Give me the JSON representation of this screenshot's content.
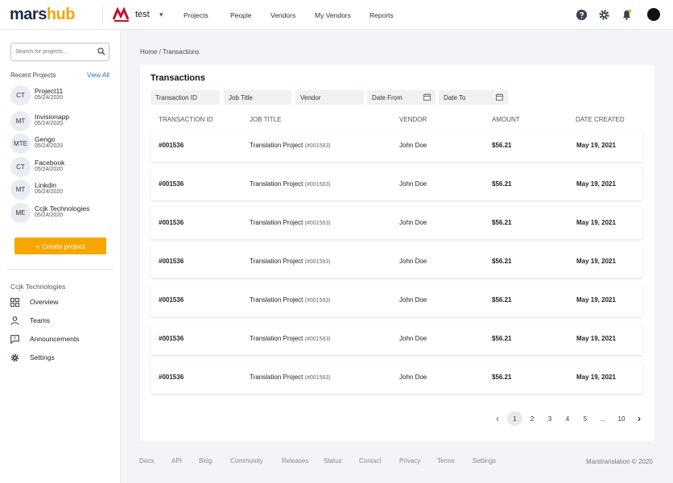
{
  "brand": {
    "part1": "mars",
    "part2": "hub",
    "color_dark": "#1b2b4a",
    "color_accent": "#f5a40a"
  },
  "workspace": {
    "name": "test",
    "logo_icon": "marstranslation-logo",
    "chevron": "▾"
  },
  "nav": [
    {
      "label": "Projects",
      "active": true
    },
    {
      "label": "People",
      "active": false
    },
    {
      "label": "Vendors",
      "active": false
    },
    {
      "label": "My Vendors",
      "active": false
    },
    {
      "label": "Reports",
      "active": false
    }
  ],
  "top_icons": [
    "help-icon",
    "gear-icon",
    "bell-icon",
    "user-avatar"
  ],
  "sidebar": {
    "search_placeholder": "Search for projects...",
    "recent_label": "Recent Projects",
    "view_all": "View All",
    "projects": [
      {
        "initials": "CT",
        "name": "Project11",
        "date": "05/24/2020"
      },
      {
        "initials": "MT",
        "name": "Invisionapp",
        "date": "05/24/2020"
      },
      {
        "initials": "MTE",
        "name": "Gengo",
        "date": "05/24/2020"
      },
      {
        "initials": "CT",
        "name": "Facebook",
        "date": "05/24/2020"
      },
      {
        "initials": "MT",
        "name": "Linkdin",
        "date": "05/24/2020"
      },
      {
        "initials": "ME",
        "name": "Ccjk Technologies",
        "date": "05/24/2020"
      }
    ],
    "create_button": "+ Create project",
    "org_label": "Ccjk Technologies",
    "links": [
      {
        "label": "Overview",
        "icon": "grid-icon"
      },
      {
        "label": "Teams",
        "icon": "person-icon"
      },
      {
        "label": "Announcements",
        "icon": "message-icon"
      },
      {
        "label": "Settings",
        "icon": "gear-icon"
      }
    ]
  },
  "breadcrumb": "Home / Transactions",
  "card": {
    "title": "Transactions",
    "filters": [
      {
        "label": "Transaction ID",
        "has_calendar": false
      },
      {
        "label": "Job Title",
        "has_calendar": false
      },
      {
        "label": "Vendor",
        "has_calendar": false
      },
      {
        "label": "Date From",
        "has_calendar": true
      },
      {
        "label": "Date To",
        "has_calendar": true
      }
    ],
    "columns": [
      "TRANSACTION ID",
      "JOB TITLE",
      "VENDOR",
      "AMOUNT",
      "DATE CREATED"
    ],
    "rows": [
      {
        "id": "#001536",
        "job": "Translation Project",
        "job_ref": "(#001583)",
        "vendor": "John Doe",
        "amount": "$56.21",
        "date": "May 19, 2021"
      },
      {
        "id": "#001536",
        "job": "Translation Project",
        "job_ref": "(#001583)",
        "vendor": "John Doe",
        "amount": "$56.21",
        "date": "May 19, 2021"
      },
      {
        "id": "#001536",
        "job": "Translation Project",
        "job_ref": "(#001583)",
        "vendor": "John Doe",
        "amount": "$56.21",
        "date": "May 19, 2021"
      },
      {
        "id": "#001536",
        "job": "Translation Project",
        "job_ref": "(#001583)",
        "vendor": "John Doe",
        "amount": "$56.21",
        "date": "May 19, 2021"
      },
      {
        "id": "#001536",
        "job": "Translation Project",
        "job_ref": "(#001583)",
        "vendor": "John Doe",
        "amount": "$56.21",
        "date": "May 19, 2021"
      },
      {
        "id": "#001536",
        "job": "Translation Project",
        "job_ref": "(#001583)",
        "vendor": "John Doe",
        "amount": "$56.21",
        "date": "May 19, 2021"
      },
      {
        "id": "#001536",
        "job": "Translation Project",
        "job_ref": "(#001583)",
        "vendor": "John Doe",
        "amount": "$56.21",
        "date": "May 19, 2021"
      }
    ],
    "pagination": {
      "prev": "‹",
      "pages": [
        "1",
        "2",
        "3",
        "4",
        "5",
        "...",
        "10"
      ],
      "current": "1",
      "next": "›"
    }
  },
  "footer": {
    "links": [
      "Docs",
      "API",
      "Blog",
      "Community",
      "Releases",
      "Status",
      "Contact",
      "Privacy",
      "Terms",
      "Settings"
    ],
    "copyright": "Marstranslation © 2020"
  }
}
